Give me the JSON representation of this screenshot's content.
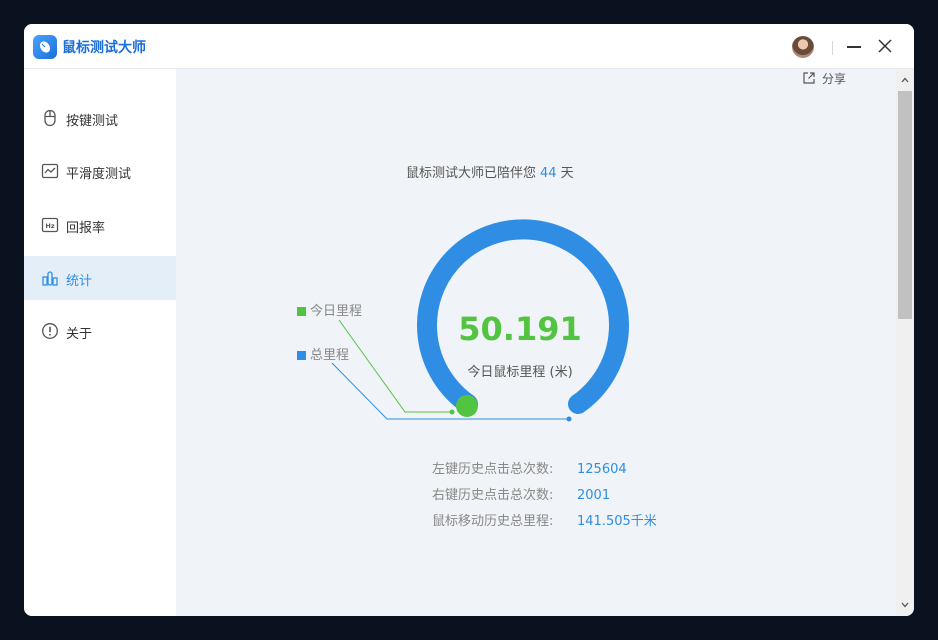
{
  "app": {
    "title": "鼠标测试大师"
  },
  "sidebar": {
    "items": [
      {
        "label": "按键测试",
        "icon": "mouse-icon"
      },
      {
        "label": "平滑度测试",
        "icon": "line-chart-icon"
      },
      {
        "label": "回报率",
        "icon": "hz-icon"
      },
      {
        "label": "统计",
        "icon": "bar-chart-icon",
        "active": true
      },
      {
        "label": "关于",
        "icon": "info-icon"
      }
    ]
  },
  "share": {
    "label": "分享",
    "icon": "share-icon"
  },
  "headline": {
    "prefix": "鼠标测试大师已陪伴您",
    "days": "44",
    "suffix": "天"
  },
  "gauge": {
    "value": "50.191",
    "label": "今日鼠标里程 (米)",
    "fill_fraction": 0.0,
    "colors": {
      "track": "#2f8ee4",
      "today": "#52c441"
    }
  },
  "legend": {
    "today": "今日里程",
    "total": "总里程"
  },
  "stats": [
    {
      "label": "左键历史点击总次数:",
      "value": "125604"
    },
    {
      "label": "右键历史点击总次数:",
      "value": "2001"
    },
    {
      "label": "鼠标移动历史总里程:",
      "value": "141.505千米"
    }
  ],
  "colors": {
    "accent": "#2f8ee4",
    "green": "#52c441"
  }
}
